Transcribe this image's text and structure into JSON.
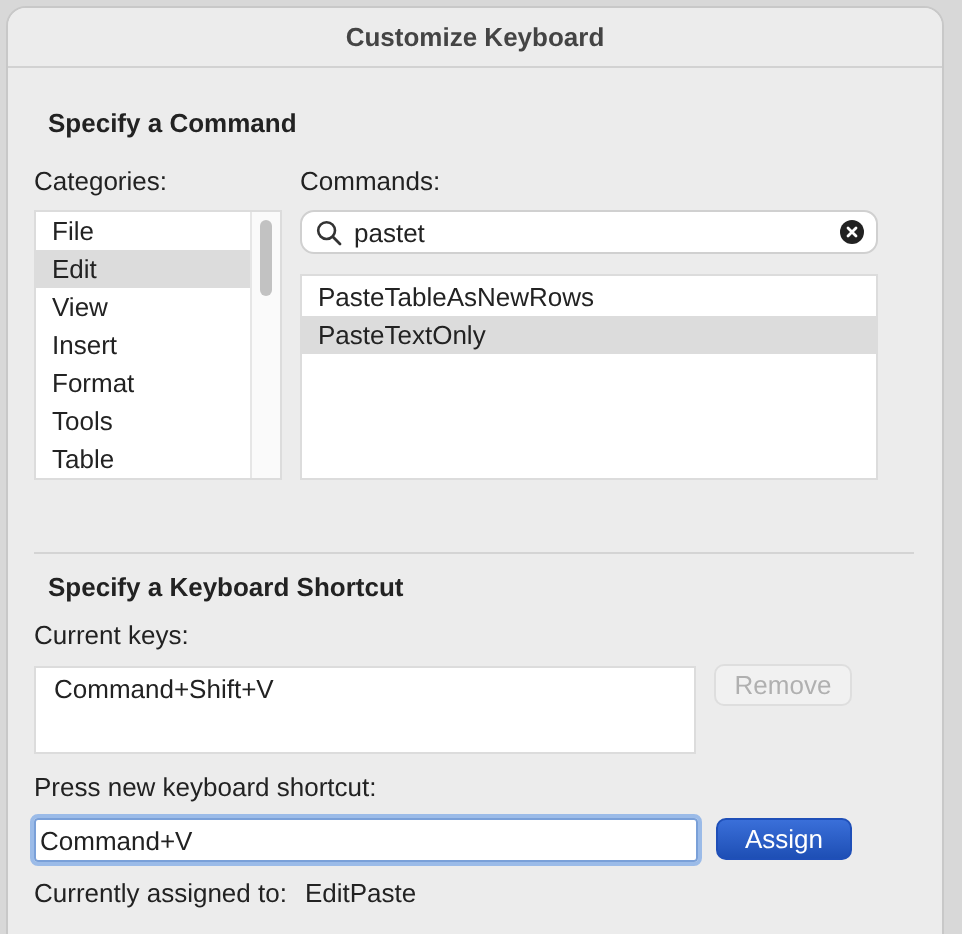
{
  "window": {
    "title": "Customize Keyboard"
  },
  "command_section": {
    "heading": "Specify a Command",
    "categories": {
      "label": "Categories:",
      "items": [
        {
          "label": "File",
          "selected": false
        },
        {
          "label": "Edit",
          "selected": true
        },
        {
          "label": "View",
          "selected": false
        },
        {
          "label": "Insert",
          "selected": false
        },
        {
          "label": "Format",
          "selected": false
        },
        {
          "label": "Tools",
          "selected": false
        },
        {
          "label": "Table",
          "selected": false
        }
      ]
    },
    "commands": {
      "label": "Commands:",
      "search": {
        "value": "pastet"
      },
      "items": [
        {
          "label": "PasteTableAsNewRows",
          "selected": false
        },
        {
          "label": "PasteTextOnly",
          "selected": true
        }
      ]
    }
  },
  "shortcut_section": {
    "heading": "Specify a Keyboard Shortcut",
    "current_keys": {
      "label": "Current keys:",
      "items": [
        "Command+Shift+V"
      ]
    },
    "remove_button": {
      "label": "Remove",
      "disabled": true
    },
    "new_shortcut": {
      "label": "Press new keyboard shortcut:",
      "value": "Command+V"
    },
    "assign_button": {
      "label": "Assign",
      "disabled": false
    },
    "assigned": {
      "label": "Currently assigned to:",
      "value": "EditPaste"
    }
  }
}
